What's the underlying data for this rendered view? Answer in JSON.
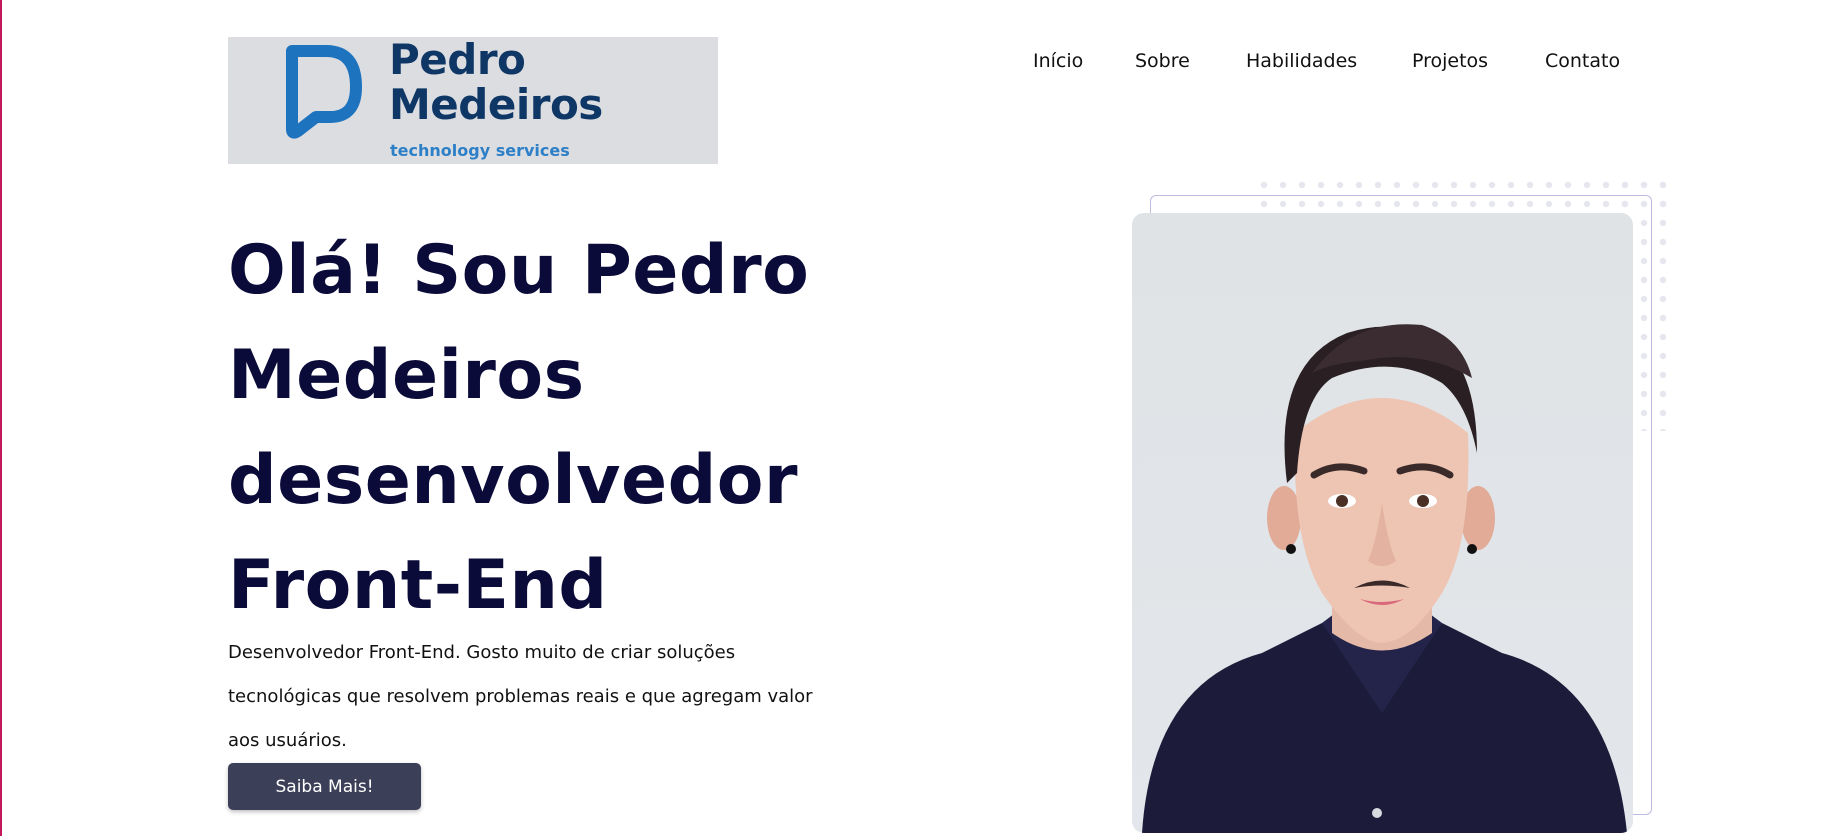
{
  "logo": {
    "line1": "Pedro",
    "line2": "Medeiros",
    "tagline": "technology services",
    "brand_color": "#0e3766",
    "accent_color": "#2d7fc7"
  },
  "nav": {
    "items": [
      {
        "label": "Início"
      },
      {
        "label": "Sobre"
      },
      {
        "label": "Habilidades"
      },
      {
        "label": "Projetos"
      },
      {
        "label": "Contato"
      }
    ]
  },
  "hero": {
    "title_lines": [
      "Olá! Sou Pedro",
      "Medeiros",
      "desenvolvedor",
      "Front-End"
    ],
    "description_lines": [
      "Desenvolvedor Front-End. Gosto muito de criar soluções",
      "tecnológicas que resolvem problemas reais e que agregam valor",
      "aos usuários."
    ],
    "cta_label": "Saiba Mais!",
    "title_color": "#0b0b3a",
    "button_color": "#3b3f57"
  },
  "icons": {
    "logo_mark": "p-logo-icon",
    "profile": "profile-photo"
  }
}
